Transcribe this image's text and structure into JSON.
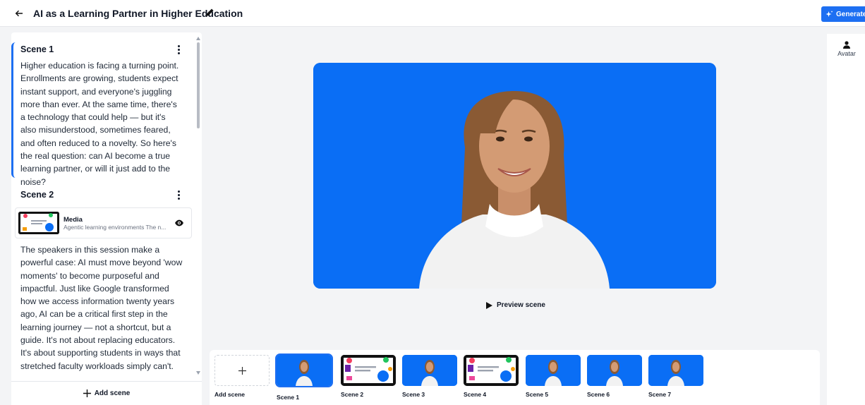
{
  "header": {
    "title": "AI as a Learning Partner in Higher Education",
    "generate_label": "Generate"
  },
  "scenes_panel": {
    "add_scene_label": "Add scene",
    "scenes": [
      {
        "name": "Scene 1",
        "text": "Higher education is facing a turning point. Enrollments are growing, students expect instant support, and everyone's juggling more than ever. At the same time, there's a technology that could help — but it's also misunderstood, sometimes feared, and often reduced to a novelty. So here's the real question: can AI become a true learning partner, or will it just add to the noise?"
      },
      {
        "name": "Scene 2",
        "media": {
          "title": "Media",
          "subtitle": "Agentic learning environments The n..."
        },
        "text": "The speakers in this session make a powerful case: AI must move beyond 'wow moments' to become purposeful and impactful. Just like Google transformed how we access information twenty years ago, AI can be a critical first step in the learning journey — not a shortcut, but a guide. It's not about replacing educators. It's about supporting students in ways that stretched faculty workloads simply can't."
      }
    ]
  },
  "preview": {
    "button_label": "Preview scene"
  },
  "right_panel": {
    "avatar_label": "Avatar"
  },
  "timeline": {
    "add_label": "Add scene",
    "tiles": [
      {
        "label": "Scene 1"
      },
      {
        "label": "Scene 2"
      },
      {
        "label": "Scene 3"
      },
      {
        "label": "Scene 4"
      },
      {
        "label": "Scene 5"
      },
      {
        "label": "Scene 6"
      },
      {
        "label": "Scene 7"
      }
    ]
  },
  "colors": {
    "accent": "#1d6ff2",
    "scene_background": "#0a6ef5"
  }
}
